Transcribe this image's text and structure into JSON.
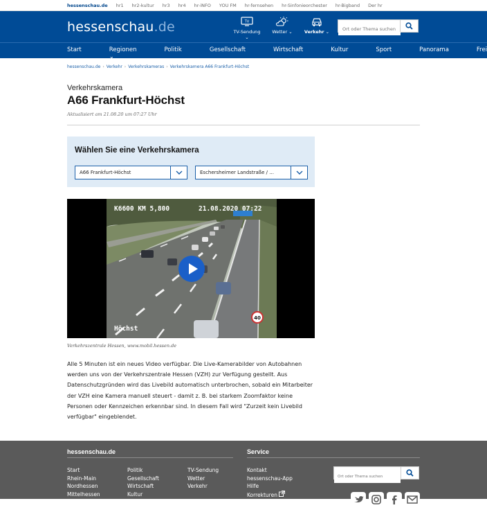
{
  "topbar": {
    "items": [
      "hessenschau.de",
      "hr1",
      "hr2-kultur",
      "hr3",
      "hr4",
      "hr-iNFO",
      "YOU FM",
      "hr-fernsehen",
      "hr-Sinfonieorchester",
      "hr-Bigband",
      "Der hr"
    ]
  },
  "header": {
    "logo_main": "hessenschau",
    "logo_suffix": ".de",
    "tv_label": "TV-Sendung",
    "weather_label": "Wetter",
    "traffic_label": "Verkehr",
    "tv_glyph": "TV",
    "search_placeholder": "Ort oder Thema suchen"
  },
  "icons": {
    "tv": "tv-icon",
    "weather": "weather-icon",
    "traffic": "car-icon",
    "search": "search-icon"
  },
  "nav": {
    "items": [
      "Start",
      "Regionen",
      "Politik",
      "Gesellschaft",
      "Wirtschaft",
      "Kultur",
      "Sport",
      "Panorama",
      "Freizeit"
    ]
  },
  "breadcrumb": [
    "hessenschau.de",
    "Verkehr",
    "Verkehrskameras",
    "Verkehrskamera A66 Frankfurt-Höchst"
  ],
  "article": {
    "kicker": "Verkehrskamera",
    "title": "A66 Frankfurt-Höchst",
    "updated": "Aktualisiert am 21.08.20 um 07:27 Uhr"
  },
  "selector": {
    "heading": "Wählen Sie eine Verkehrskamera",
    "select1_value": "A66 Frankfurt-Höchst",
    "select2_value": "Eschersheimer Landstraße / ..."
  },
  "video": {
    "overlay_left": "K6600 KM 5,800",
    "overlay_right": "21.08.2020 07:22",
    "location_label": "Höchst",
    "sign_text": "40"
  },
  "caption": "Verkehrszentrale Hessen, www.mobil.hessen.de",
  "body_text": "Alle 5 Minuten ist ein neues Video verfügbar. Die Live-Kamerabilder von Autobahnen werden uns von der Verkehrszentrale Hessen (VZH) zur Verfügung gestellt. Aus Datenschutzgründen wird das Livebild automatisch unterbrochen, sobald ein Mitarbeiter der VZH eine Kamera manuell steuert - damit z. B. bei starkem Zoomfaktor keine Personen oder Kennzeichen erkennbar sind. In diesem Fall wird \"Zurzeit kein Livebild verfügbar\" eingeblendet.",
  "footer": {
    "heading_left": "hessenschau.de",
    "heading_right": "Service",
    "col1": [
      "Start",
      "Rhein-Main",
      "Nordhessen",
      "Mittelhessen"
    ],
    "col2": [
      "Politik",
      "Gesellschaft",
      "Wirtschaft",
      "Kultur"
    ],
    "col3": [
      "TV-Sendung",
      "Wetter",
      "Verkehr"
    ],
    "col4": [
      "Kontakt",
      "hessenschau-App",
      "Hilfe",
      "Korrekturen"
    ],
    "search_placeholder": "Ort oder Thema suchen",
    "social": [
      "twitter-icon",
      "instagram-icon",
      "facebook-icon",
      "mail-icon"
    ]
  },
  "colors": {
    "brand_blue": "#004b96",
    "selector_bg": "#dfebf6",
    "footer_bg": "#5a5a5a",
    "play_button": "#1a5fc8"
  }
}
